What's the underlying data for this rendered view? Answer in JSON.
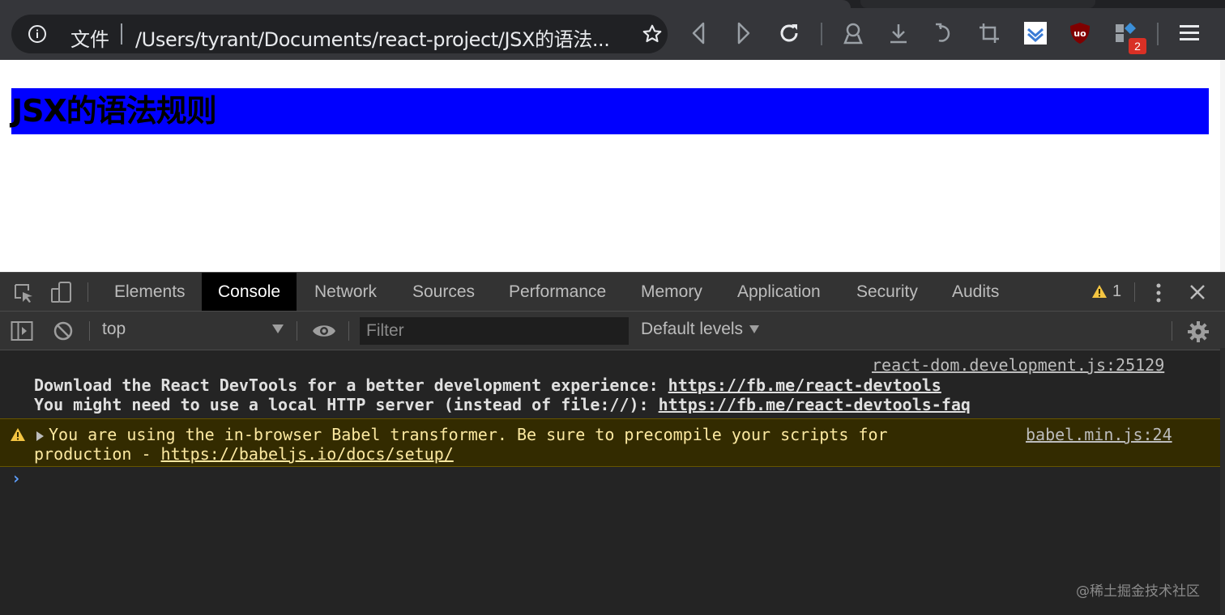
{
  "browser": {
    "omnibox": {
      "scheme_label": "文件",
      "url": "/Users/tyrant/Documents/react-project/JSX的语法..."
    },
    "extension_badge": "2"
  },
  "page": {
    "heading": "JSX的语法规则",
    "heading_background": "#0000ff"
  },
  "devtools": {
    "tabs": [
      "Elements",
      "Console",
      "Network",
      "Sources",
      "Performance",
      "Memory",
      "Application",
      "Security",
      "Audits"
    ],
    "active_tab": "Console",
    "warning_count": "1",
    "context": "top",
    "filter_placeholder": "Filter",
    "levels": "Default levels",
    "messages": {
      "info": {
        "source": "react-dom.development.js:25129",
        "line1_text": "Download the React DevTools for a better development experience: ",
        "line1_link": "https://fb.me/react-devtools",
        "line2_text": "You might need to use a local HTTP server (instead of file://): ",
        "line2_link": "https://fb.me/react-devtools-faq"
      },
      "warning": {
        "source": "babel.min.js:24",
        "line1_text": "You are using the in-browser Babel transformer. Be sure to precompile your scripts for",
        "line2_text": "production - ",
        "line2_link": "https://babeljs.io/docs/setup/"
      }
    },
    "prompt_symbol": "›"
  },
  "watermark": "@稀土掘金技术社区",
  "colors": {
    "toolbar": "#35363a",
    "devtools_bg": "#242424",
    "warning_bg": "#332b00",
    "warning_text": "#fce9a1",
    "prompt": "#5ea0ff"
  }
}
